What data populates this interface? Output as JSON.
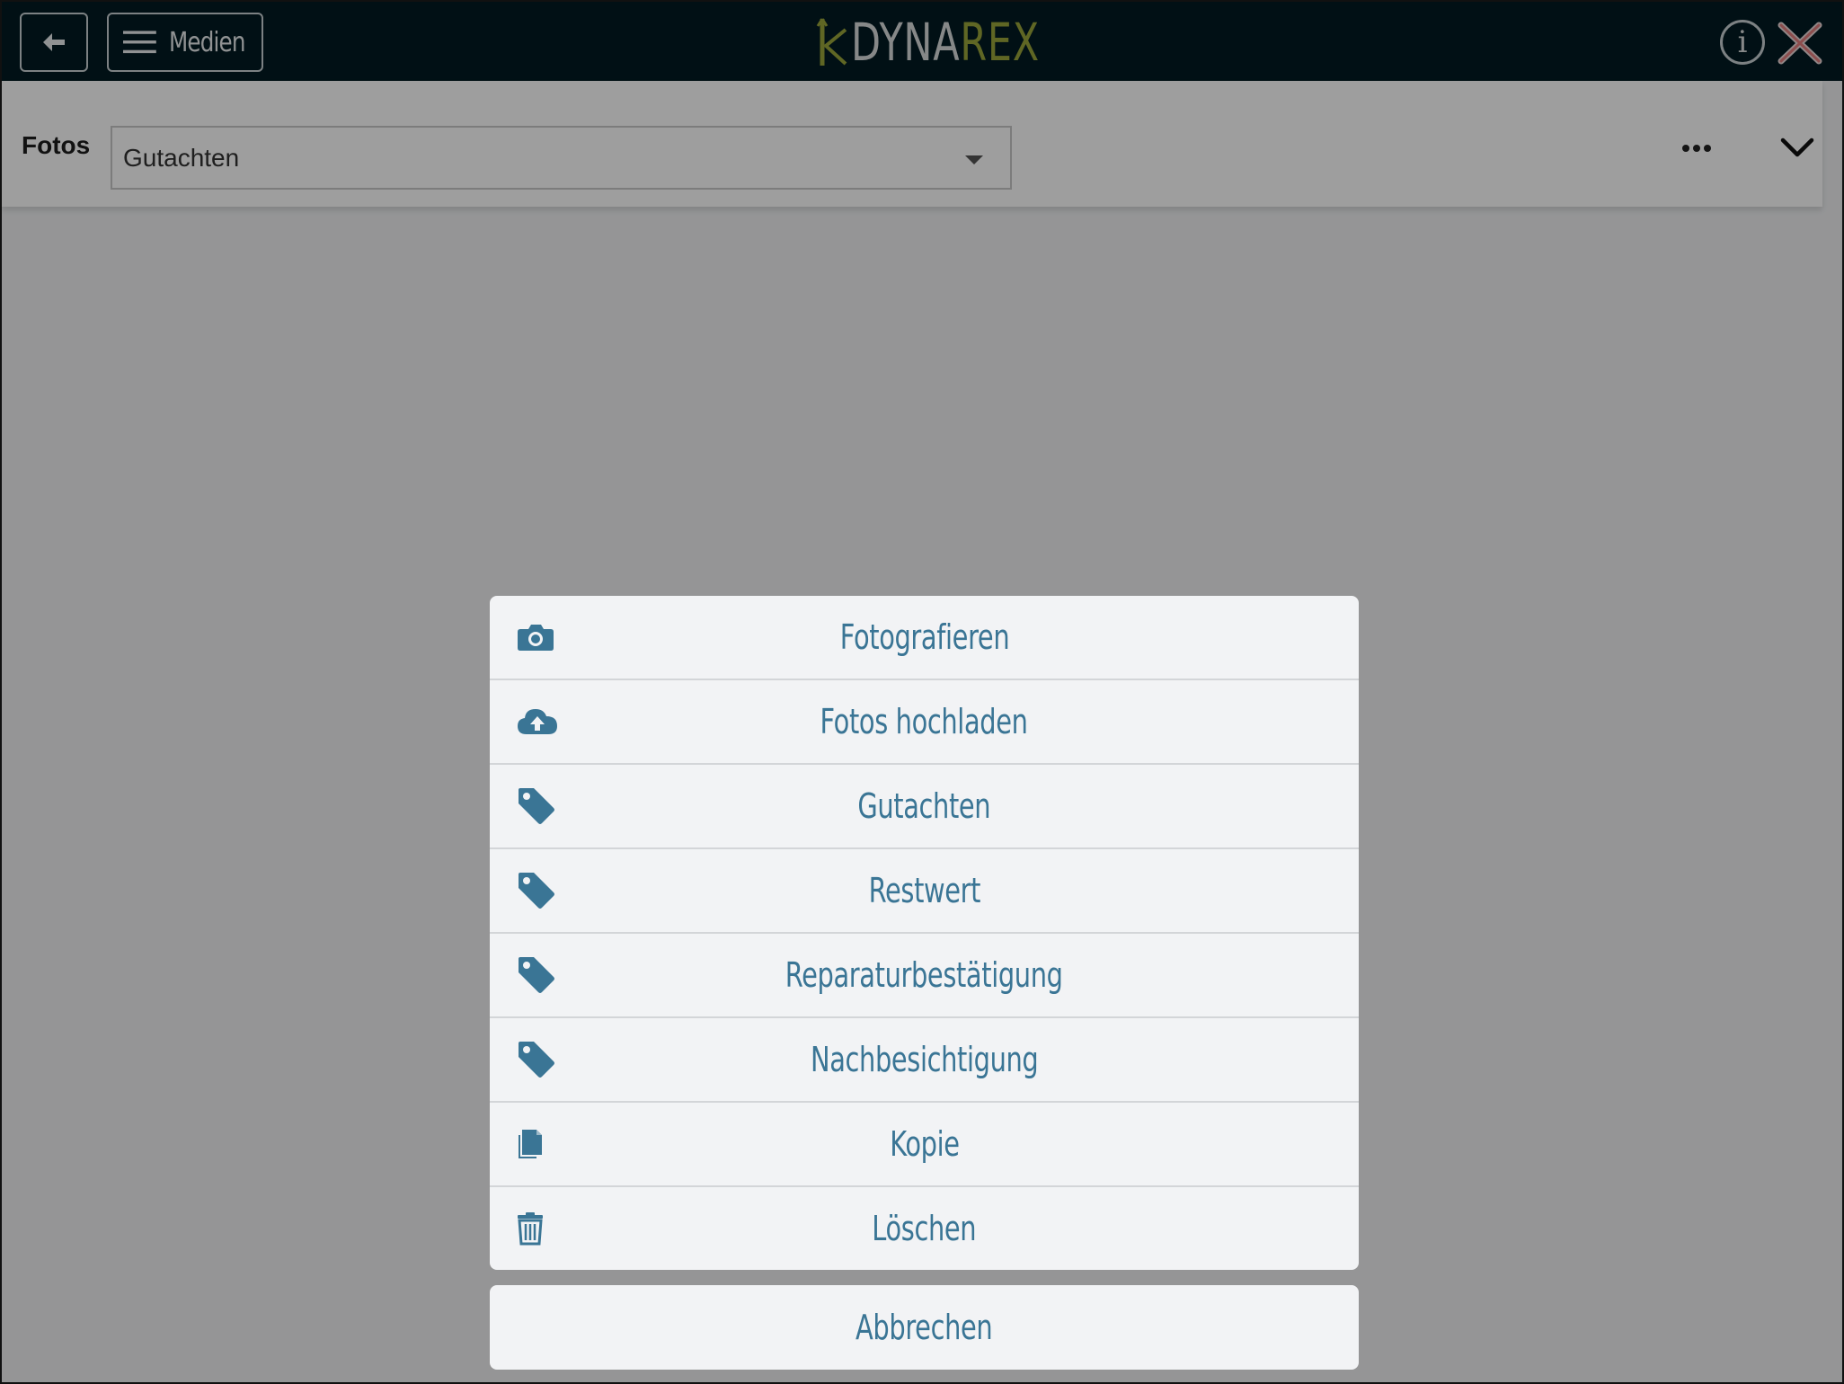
{
  "header": {
    "menu_label": "Medien",
    "logo_part1": "DYNA",
    "logo_part2": "REX",
    "info_glyph": "i",
    "icons": {
      "back": "arrow-left-icon",
      "menu": "hamburger-icon",
      "info": "info-icon",
      "close": "close-icon"
    }
  },
  "toolbar": {
    "label": "Fotos",
    "select_value": "Gutachten",
    "icons": {
      "more": "ellipsis-icon",
      "collapse": "chevron-down-icon"
    }
  },
  "action_sheet": {
    "items": [
      {
        "label": "Fotografieren",
        "icon": "camera-icon"
      },
      {
        "label": "Fotos hochladen",
        "icon": "cloud-upload-icon"
      },
      {
        "label": "Gutachten",
        "icon": "tag-icon"
      },
      {
        "label": "Restwert",
        "icon": "tag-icon"
      },
      {
        "label": "Reparaturbestätigung",
        "icon": "tag-icon"
      },
      {
        "label": "Nachbesichtigung",
        "icon": "tag-icon"
      },
      {
        "label": "Kopie",
        "icon": "document-icon"
      },
      {
        "label": "Löschen",
        "icon": "trash-icon"
      }
    ],
    "cancel_label": "Abbrechen"
  },
  "colors": {
    "header_bg": "#021a22",
    "logo_accent": "#9aa53a",
    "action_text": "#3a7595",
    "sheet_bg": "#f2f3f5",
    "overlay": "rgba(0,0,0,0.38)"
  }
}
